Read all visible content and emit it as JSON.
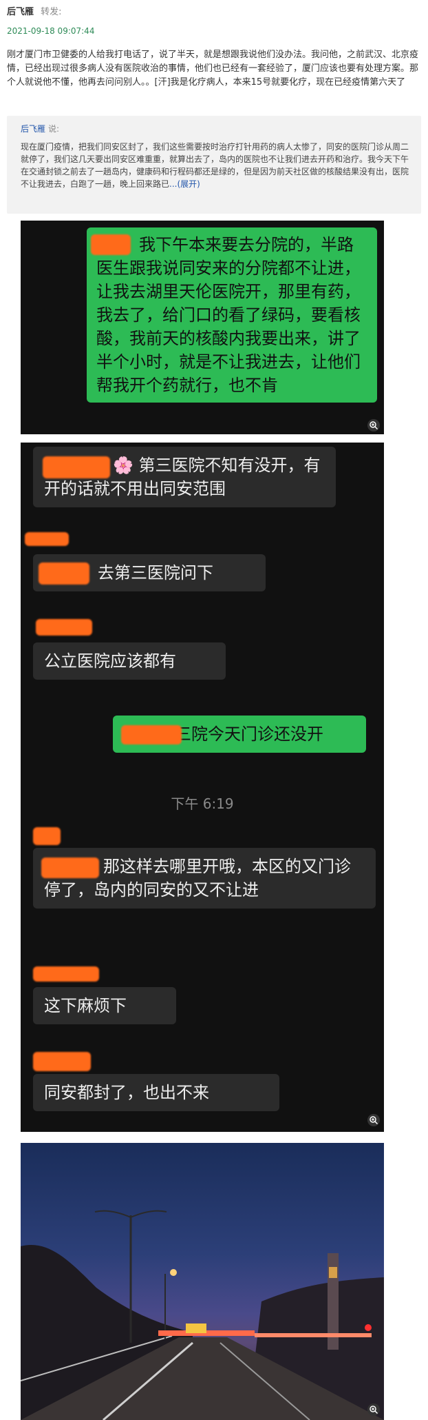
{
  "post": {
    "author": "后飞雁",
    "action": "转发:",
    "time": "2021-09-18 09:07:44",
    "text": "刚才厦门市卫健委的人给我打电话了，说了半天，就是想跟我说他们没办法。我问他，之前武汉、北京疫情，已经出现过很多病人没有医院收治的事情，他们也已经有一套经验了，厦门应该也要有处理方案。那个人就说他不懂，他再去问问别人。。[汗]我是化疗病人，本来15号就要化疗，现在已经疫情第六天了"
  },
  "quote": {
    "author": "后飞雁",
    "says": "说:",
    "text": "现在厦门疫情，把我们同安区封了，我们这些需要按时治疗打针用药的病人太惨了，同安的医院门诊从周二就停了，我们这几天要出同安区难重重，就算出去了，岛内的医院也不让我们进去开药和治疗。我今天下午在交通封锁之前去了一趟岛内，健康码和行程码都还是绿的，但是因为前天社区做的核酸结果没有出，医院不让我进去，白跑了一趟，晚上回来路已",
    "expand": "...(展开)"
  },
  "screenshot1": {
    "message": "我下午本来要去分院的，半路医生跟我说同安来的分院都不让进，让我去湖里天伦医院开，那里有药，我去了，给门口的看了绿码，要看核酸，我前天的核酸内我要出来，讲了半个小时，就是不让我进去，让他们帮我开个药就行，也不肯"
  },
  "screenshot2": {
    "messages": [
      {
        "side": "left",
        "text": "第三医院不知有没开，有开的话就不用出同安范围"
      },
      {
        "side": "left",
        "text": "去第三医院问下"
      },
      {
        "side": "left",
        "text": "公立医院应该都有"
      },
      {
        "side": "right",
        "text": "三院今天门诊还没开"
      },
      {
        "side": "left",
        "text": "那这样去哪里开哦，本区的又门诊停了，岛内的同安的又不让进"
      },
      {
        "side": "left",
        "text": "这下麻烦下"
      },
      {
        "side": "left",
        "text": "同安都封了，也出不来"
      }
    ],
    "timestamp": "下午 6:19",
    "flower": "🌸"
  },
  "icons": {
    "zoom": "zoom-in-icon"
  },
  "colors": {
    "green_bubble": "#2dbb55",
    "redaction": "#ff6a1a",
    "time_green": "#2e8b57",
    "link_blue": "#2255aa"
  }
}
